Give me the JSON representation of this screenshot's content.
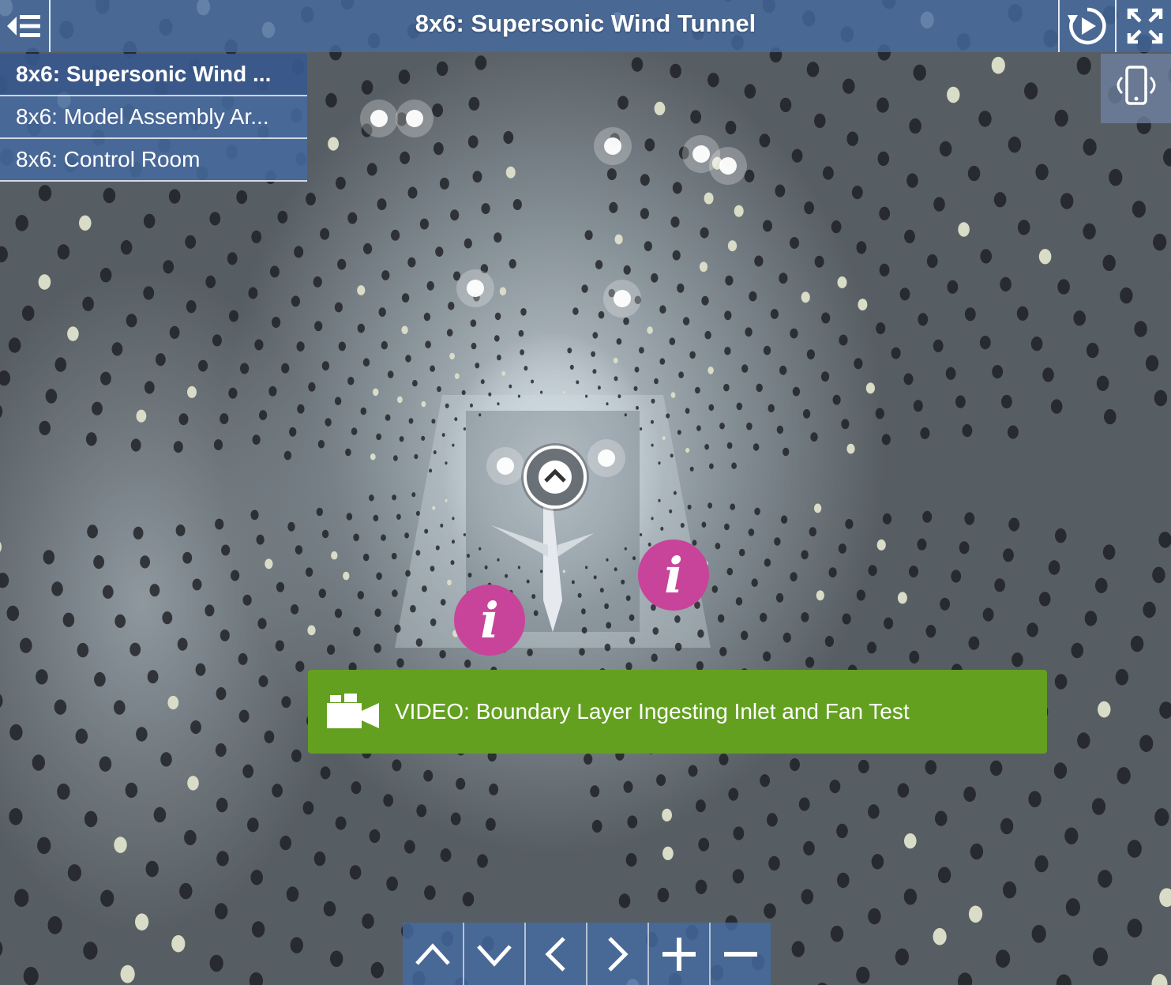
{
  "header": {
    "title": "8x6: Supersonic Wind Tunnel"
  },
  "scenes": [
    {
      "label": "8x6: Supersonic Wind ...",
      "active": true
    },
    {
      "label": "8x6: Model Assembly Ar...",
      "active": false
    },
    {
      "label": "8x6: Control Room",
      "active": false
    }
  ],
  "hotspots": {
    "info_symbol": "i",
    "video_label": "VIDEO: Boundary Layer Ingesting Inlet and Fan Test"
  },
  "controls": [
    "up-arrow",
    "down-arrow",
    "left-arrow",
    "right-arrow",
    "zoom-in",
    "zoom-out"
  ],
  "icons": {
    "menu": "menu-collapse-icon",
    "autoplay": "autoplay-rotate-icon",
    "fullscreen": "fullscreen-icon",
    "gyro": "gyro-phone-icon",
    "video": "video-camera-icon"
  },
  "colors": {
    "bar": "#466aa0",
    "info_hotspot": "#c8449a",
    "video_banner": "#63a020"
  }
}
